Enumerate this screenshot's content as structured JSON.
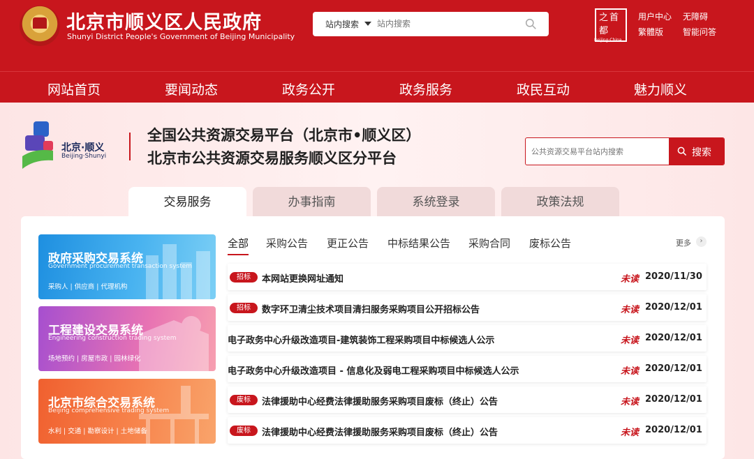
{
  "header": {
    "title": "北京市顺义区人民政府",
    "subtitle": "Shunyi District People's Government of Beijing Municipality",
    "search": {
      "scope": "站内搜索",
      "placeholder": "站内搜索"
    },
    "beijing_logo": {
      "text": "之首都",
      "sub": "Beijing·China"
    },
    "links": [
      "用户中心",
      "无障碍",
      "繁體版",
      "智能问答"
    ]
  },
  "nav": {
    "items": [
      "网站首页",
      "要闻动态",
      "政务公开",
      "政务服务",
      "政民互动",
      "魅力顺义"
    ]
  },
  "platform": {
    "logo": {
      "cn": "北京·顺义",
      "en": "Beijing·Shunyi"
    },
    "title_line1": "全国公共资源交易平台（北京市•顺义区）",
    "title_line2": "北京市公共资源交易服务顺义区分平台",
    "search": {
      "placeholder": "公共资源交易平台站内搜索",
      "button": "搜索"
    }
  },
  "tabs": [
    "交易服务",
    "办事指南",
    "系统登录",
    "政策法规"
  ],
  "systems": [
    {
      "title": "政府采购交易系统",
      "en": "Government procurement transaction system",
      "tags": "采购人 | 供应商 | 代理机构",
      "color": "#1e8fe0"
    },
    {
      "title": "工程建设交易系统",
      "en": "Engineering construction trading system",
      "tags": "场地预约 | 房屋市政 | 园林绿化",
      "color": "#a64fcf"
    },
    {
      "title": "北京市综合交易系统",
      "en": "Beijing comprehensive trading system",
      "tags": "水利 | 交通 | 勘察设计 | 土地储备",
      "color": "#f0602f"
    }
  ],
  "filter_tabs": [
    "全部",
    "采购公告",
    "更正公告",
    "中标结果公告",
    "采购合同",
    "废标公告"
  ],
  "more_label": "更多",
  "notices": [
    {
      "badge": "招标",
      "title": "本网站更换网址通知",
      "status": "未读",
      "date": "2020/11/30"
    },
    {
      "badge": "招标",
      "title": "数字环卫清尘技术项目清扫服务采购项目公开招标公告",
      "status": "未读",
      "date": "2020/12/01"
    },
    {
      "badge": "",
      "title": "电子政务中心升级改造项目-建筑装饰工程采购项目中标候选人公示",
      "status": "未读",
      "date": "2020/12/01"
    },
    {
      "badge": "",
      "title": "电子政务中心升级改造项目 - 信息化及弱电工程采购项目中标候选人公示",
      "status": "未读",
      "date": "2020/12/01"
    },
    {
      "badge": "废标",
      "title": "法律援助中心经费法律援助服务采购项目废标（终止）公告",
      "status": "未读",
      "date": "2020/12/01"
    },
    {
      "badge": "废标",
      "title": "法律援助中心经费法律援助服务采购项目废标（终止）公告",
      "status": "未读",
      "date": "2020/12/01"
    }
  ],
  "colors": {
    "brand_red": "#c8161d",
    "band_pink": "#fde5e5"
  }
}
